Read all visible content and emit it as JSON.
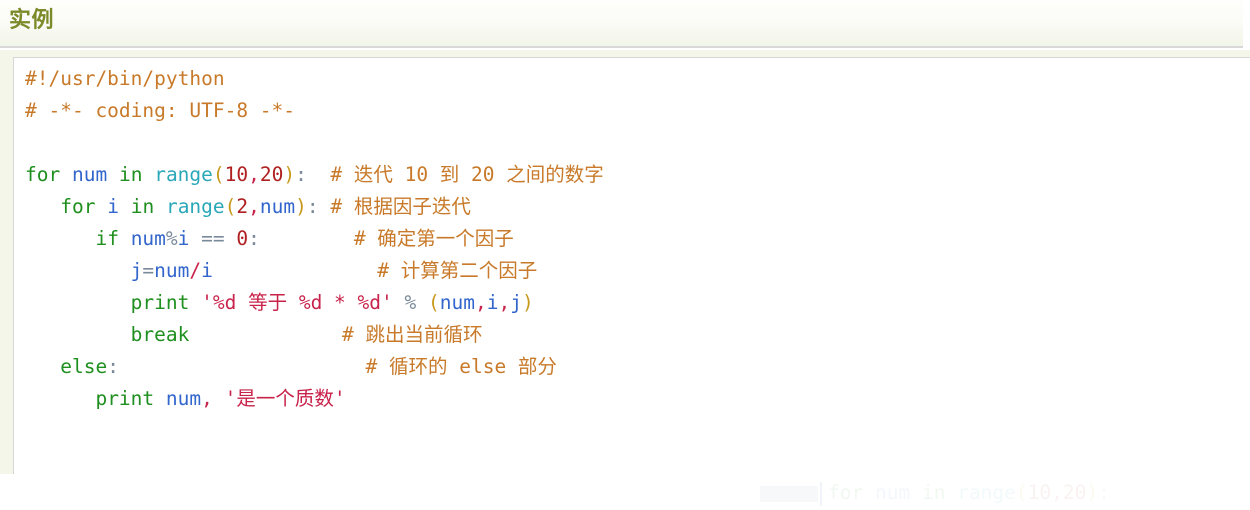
{
  "header": {
    "title": "实例"
  },
  "code_block": {
    "language": "python",
    "lines": [
      {
        "id": "line-shebang",
        "tokens": [
          {
            "t": "#!/usr/bin/python",
            "c": "tok-comment"
          }
        ]
      },
      {
        "id": "line-coding",
        "tokens": [
          {
            "t": "# -*- coding: UTF-8 -*-",
            "c": "tok-comment"
          }
        ]
      },
      {
        "id": "line-blank-1",
        "tokens": [
          {
            "t": " ",
            "c": "tok-plain"
          }
        ]
      },
      {
        "id": "line-for-num",
        "tokens": [
          {
            "t": "for",
            "c": "tok-kw"
          },
          {
            "t": " ",
            "c": "tok-plain"
          },
          {
            "t": "num",
            "c": "tok-name"
          },
          {
            "t": " ",
            "c": "tok-plain"
          },
          {
            "t": "in",
            "c": "tok-kw"
          },
          {
            "t": " ",
            "c": "tok-plain"
          },
          {
            "t": "range",
            "c": "tok-builtin"
          },
          {
            "t": "(",
            "c": "tok-punc"
          },
          {
            "t": "10",
            "c": "tok-num"
          },
          {
            "t": ",",
            "c": "tok-str"
          },
          {
            "t": "20",
            "c": "tok-num"
          },
          {
            "t": ")",
            "c": "tok-punc"
          },
          {
            "t": ":",
            "c": "tok-op"
          },
          {
            "t": "  ",
            "c": "tok-plain"
          },
          {
            "t": "# 迭代 10 到 20 之间的数字",
            "c": "tok-comment"
          }
        ]
      },
      {
        "id": "line-for-i",
        "tokens": [
          {
            "t": "   ",
            "c": "tok-plain"
          },
          {
            "t": "for",
            "c": "tok-kw"
          },
          {
            "t": " ",
            "c": "tok-plain"
          },
          {
            "t": "i",
            "c": "tok-name"
          },
          {
            "t": " ",
            "c": "tok-plain"
          },
          {
            "t": "in",
            "c": "tok-kw"
          },
          {
            "t": " ",
            "c": "tok-plain"
          },
          {
            "t": "range",
            "c": "tok-builtin"
          },
          {
            "t": "(",
            "c": "tok-punc"
          },
          {
            "t": "2",
            "c": "tok-num"
          },
          {
            "t": ",",
            "c": "tok-str"
          },
          {
            "t": "num",
            "c": "tok-name"
          },
          {
            "t": ")",
            "c": "tok-punc"
          },
          {
            "t": ":",
            "c": "tok-op"
          },
          {
            "t": " ",
            "c": "tok-plain"
          },
          {
            "t": "# 根据因子迭代",
            "c": "tok-comment"
          }
        ]
      },
      {
        "id": "line-if-mod",
        "tokens": [
          {
            "t": "      ",
            "c": "tok-plain"
          },
          {
            "t": "if",
            "c": "tok-kw"
          },
          {
            "t": " ",
            "c": "tok-plain"
          },
          {
            "t": "num",
            "c": "tok-name"
          },
          {
            "t": "%",
            "c": "tok-op"
          },
          {
            "t": "i",
            "c": "tok-name"
          },
          {
            "t": " ",
            "c": "tok-plain"
          },
          {
            "t": "==",
            "c": "tok-op"
          },
          {
            "t": " ",
            "c": "tok-plain"
          },
          {
            "t": "0",
            "c": "tok-num"
          },
          {
            "t": ":",
            "c": "tok-op"
          },
          {
            "t": "        ",
            "c": "tok-plain"
          },
          {
            "t": "# 确定第一个因子",
            "c": "tok-comment"
          }
        ]
      },
      {
        "id": "line-j-assign",
        "tokens": [
          {
            "t": "         ",
            "c": "tok-plain"
          },
          {
            "t": "j",
            "c": "tok-name"
          },
          {
            "t": "=",
            "c": "tok-op"
          },
          {
            "t": "num",
            "c": "tok-name"
          },
          {
            "t": "/",
            "c": "tok-str"
          },
          {
            "t": "i",
            "c": "tok-name"
          },
          {
            "t": "              ",
            "c": "tok-plain"
          },
          {
            "t": "# 计算第二个因子",
            "c": "tok-comment"
          }
        ]
      },
      {
        "id": "line-print-fmt",
        "tokens": [
          {
            "t": "         ",
            "c": "tok-plain"
          },
          {
            "t": "print",
            "c": "tok-kw"
          },
          {
            "t": " ",
            "c": "tok-plain"
          },
          {
            "t": "'%d 等于 %d * %d'",
            "c": "tok-str"
          },
          {
            "t": " ",
            "c": "tok-plain"
          },
          {
            "t": "%",
            "c": "tok-op"
          },
          {
            "t": " ",
            "c": "tok-plain"
          },
          {
            "t": "(",
            "c": "tok-punc"
          },
          {
            "t": "num",
            "c": "tok-name"
          },
          {
            "t": ",",
            "c": "tok-str"
          },
          {
            "t": "i",
            "c": "tok-name"
          },
          {
            "t": ",",
            "c": "tok-str"
          },
          {
            "t": "j",
            "c": "tok-name"
          },
          {
            "t": ")",
            "c": "tok-punc"
          }
        ]
      },
      {
        "id": "line-break",
        "tokens": [
          {
            "t": "         ",
            "c": "tok-plain"
          },
          {
            "t": "break",
            "c": "tok-kw"
          },
          {
            "t": "             ",
            "c": "tok-plain"
          },
          {
            "t": "# 跳出当前循环",
            "c": "tok-comment"
          }
        ]
      },
      {
        "id": "line-else",
        "tokens": [
          {
            "t": "   ",
            "c": "tok-plain"
          },
          {
            "t": "else",
            "c": "tok-kw"
          },
          {
            "t": ":",
            "c": "tok-op"
          },
          {
            "t": "                     ",
            "c": "tok-plain"
          },
          {
            "t": "# 循环的 else 部分",
            "c": "tok-comment"
          }
        ]
      },
      {
        "id": "line-print-num",
        "tokens": [
          {
            "t": "      ",
            "c": "tok-plain"
          },
          {
            "t": "print",
            "c": "tok-kw"
          },
          {
            "t": " ",
            "c": "tok-plain"
          },
          {
            "t": "num",
            "c": "tok-name"
          },
          {
            "t": ",",
            "c": "tok-str"
          },
          {
            "t": " ",
            "c": "tok-plain"
          },
          {
            "t": "'是一个质数'",
            "c": "tok-str"
          }
        ]
      }
    ]
  },
  "ghost_overlay": {
    "text": "for num in range(10,20):",
    "tokens": [
      {
        "t": "for",
        "c": "tok-kw"
      },
      {
        "t": " ",
        "c": "tok-plain"
      },
      {
        "t": "num",
        "c": "tok-name"
      },
      {
        "t": " ",
        "c": "tok-plain"
      },
      {
        "t": "in",
        "c": "tok-kw"
      },
      {
        "t": " ",
        "c": "tok-plain"
      },
      {
        "t": "range",
        "c": "tok-builtin"
      },
      {
        "t": "(",
        "c": "tok-punc"
      },
      {
        "t": "10",
        "c": "tok-num"
      },
      {
        "t": ",",
        "c": "tok-str"
      },
      {
        "t": "20",
        "c": "tok-num"
      },
      {
        "t": ")",
        "c": "tok-punc"
      },
      {
        "t": ":",
        "c": "tok-op"
      }
    ]
  },
  "colors": {
    "header_title": "#7c8a2a",
    "header_border": "#d9d9d9",
    "gutter_bg": "#f4f6e9",
    "panel_bg": "#ffffff",
    "panel_border": "#d7d7d7",
    "comment": "#c87a2a",
    "keyword": "#1f8f1f",
    "builtin": "#2aa8b8",
    "name": "#3366cc",
    "number": "#b02020",
    "string": "#c8234a",
    "operator": "#7a8a9a",
    "punctuation": "#c79a1e"
  }
}
